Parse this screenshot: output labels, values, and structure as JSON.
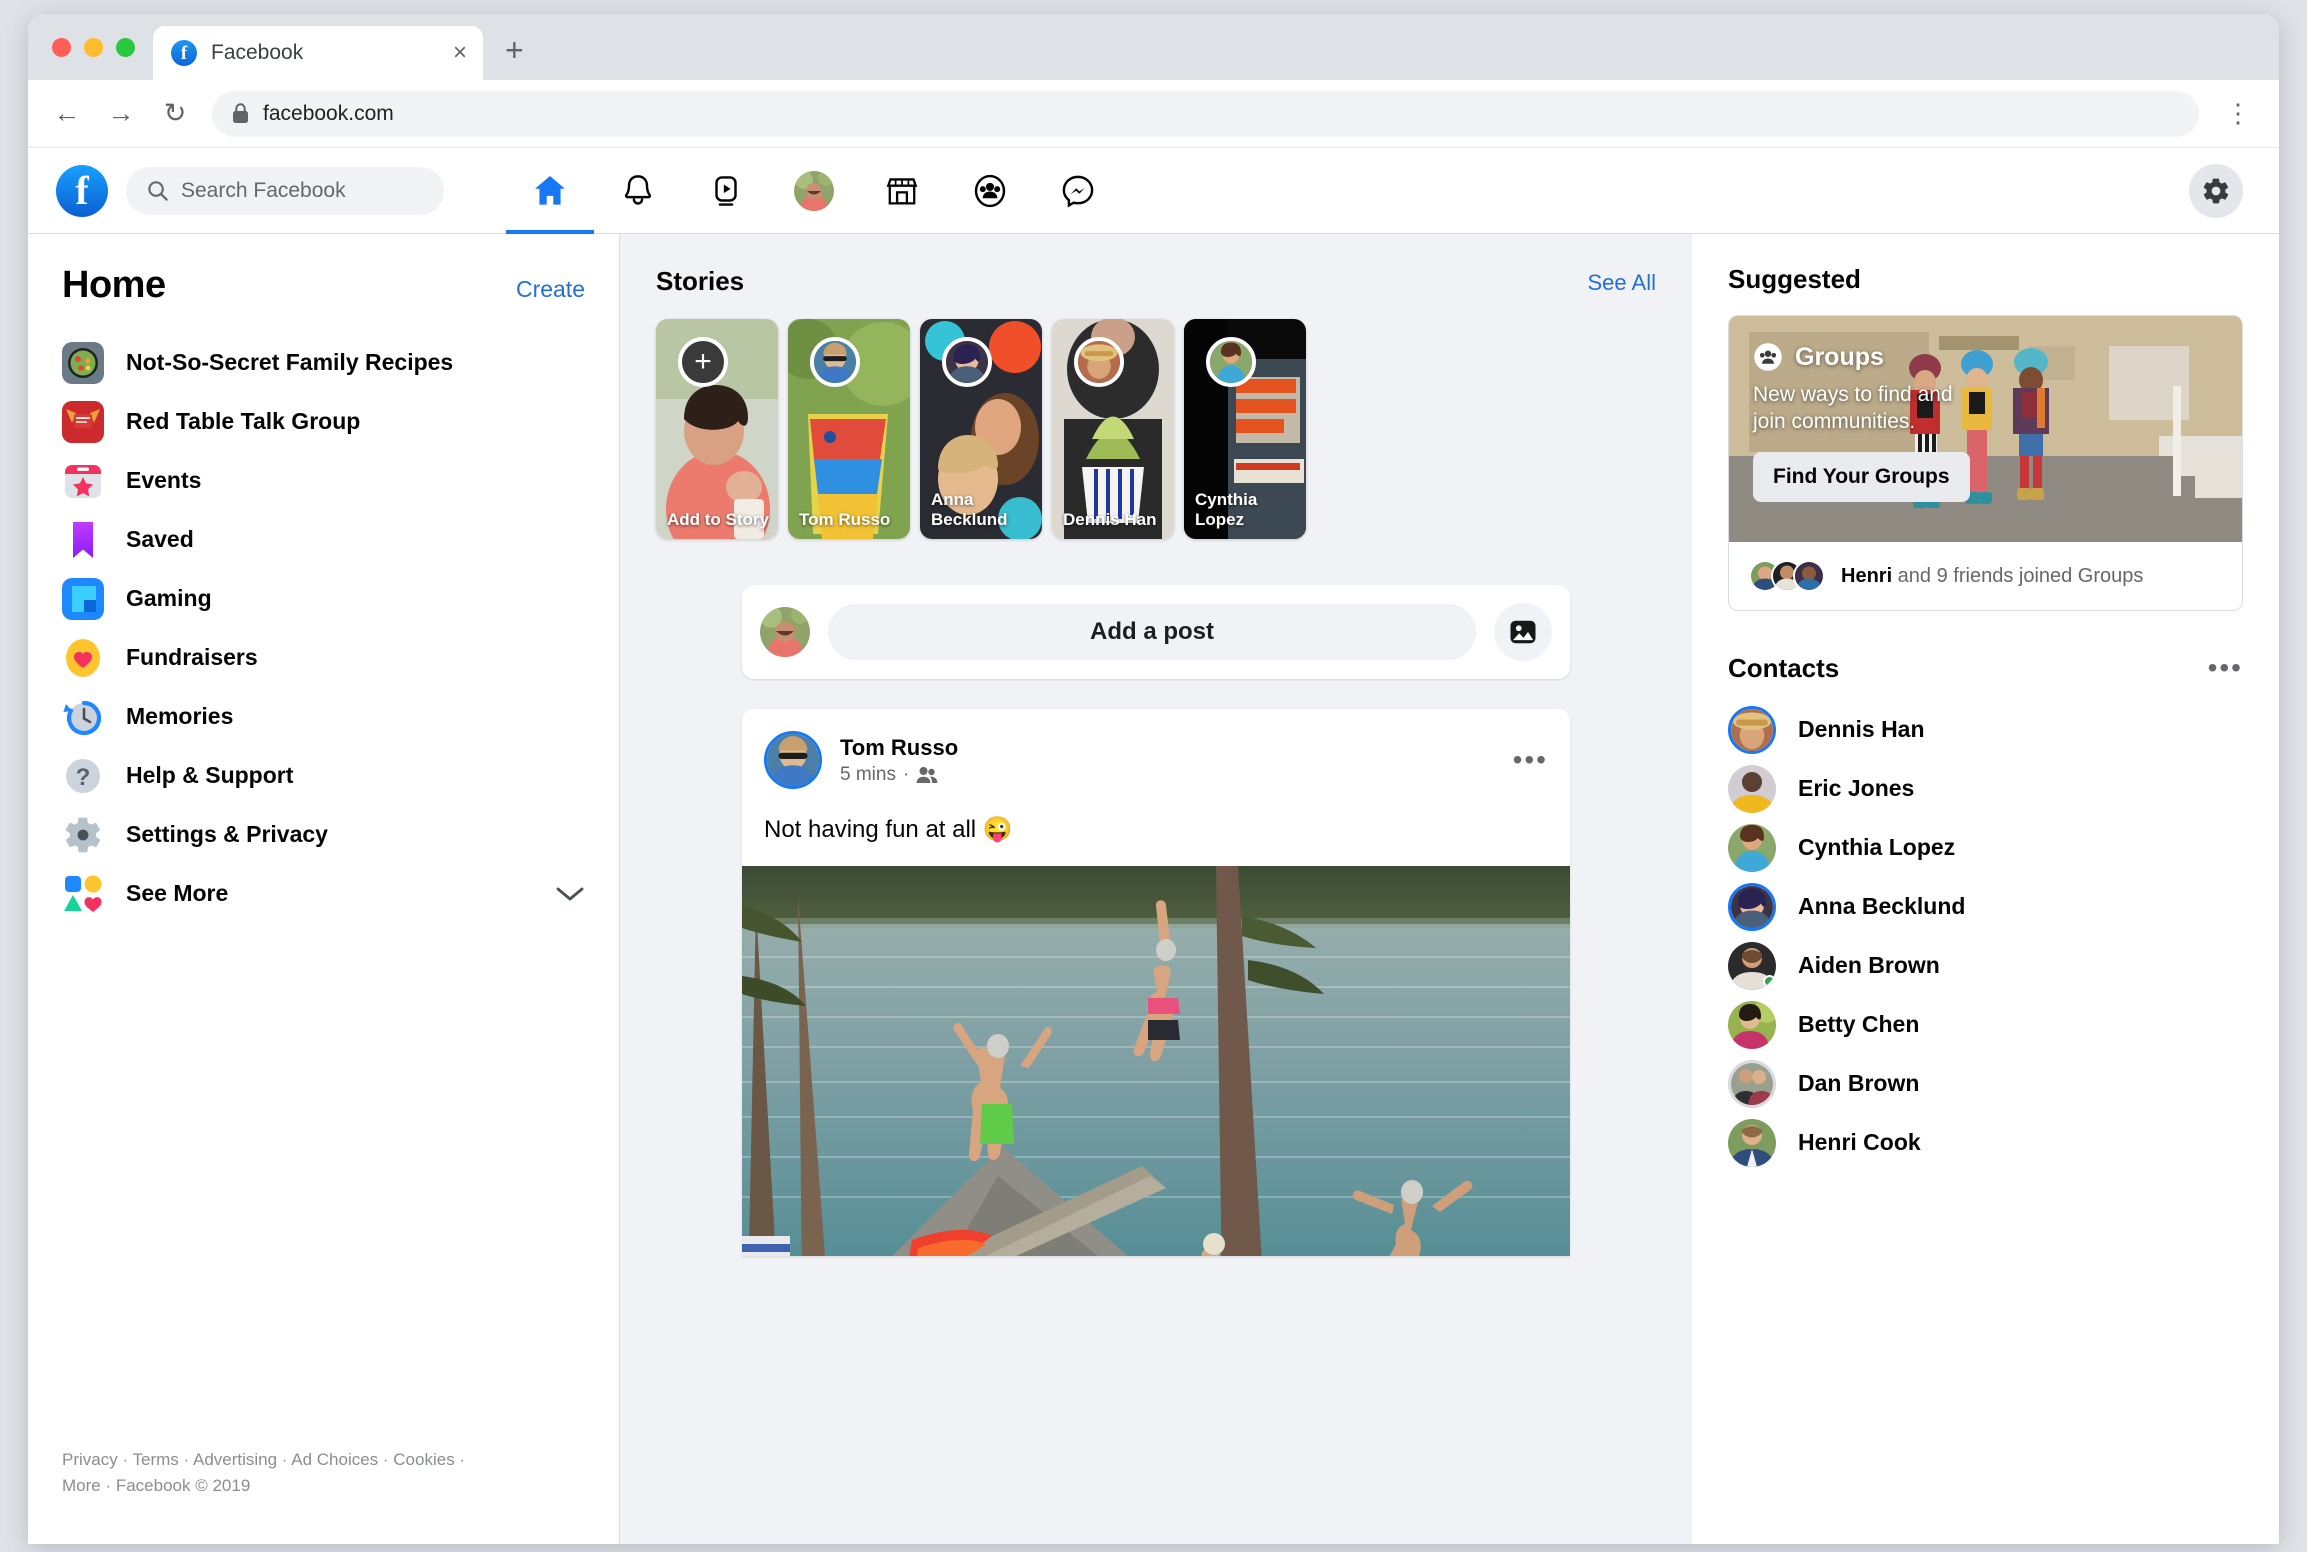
{
  "browser": {
    "tab_title": "Facebook",
    "tab_favicon": "facebook-f-icon",
    "close_glyph": "×",
    "new_tab_glyph": "+",
    "back_glyph": "←",
    "forward_glyph": "→",
    "reload_glyph": "↻",
    "lock_glyph": "🔒",
    "url": "facebook.com",
    "menu_glyph": "⋮"
  },
  "header": {
    "logo_letter": "f",
    "search_placeholder": "Search Facebook",
    "nav": [
      {
        "name": "home",
        "label": "Home",
        "active": true
      },
      {
        "name": "notifications",
        "label": "Notifications",
        "active": false
      },
      {
        "name": "watch",
        "label": "Watch",
        "active": false
      },
      {
        "name": "profile",
        "label": "Profile",
        "active": false
      },
      {
        "name": "marketplace",
        "label": "Marketplace",
        "active": false
      },
      {
        "name": "groups",
        "label": "Groups",
        "active": false
      },
      {
        "name": "messenger",
        "label": "Messenger",
        "active": false
      }
    ],
    "settings_label": "Settings"
  },
  "sidebar": {
    "title": "Home",
    "create_label": "Create",
    "items": [
      {
        "label": "Not-So-Secret Family Recipes",
        "icon": "group-photo-icon"
      },
      {
        "label": "Red Table Talk Group",
        "icon": "group-photo-icon"
      },
      {
        "label": "Events",
        "icon": "events-calendar-icon"
      },
      {
        "label": "Saved",
        "icon": "bookmark-icon"
      },
      {
        "label": "Gaming",
        "icon": "gaming-icon"
      },
      {
        "label": "Fundraisers",
        "icon": "heart-icon"
      },
      {
        "label": "Memories",
        "icon": "clock-icon"
      },
      {
        "label": "Help & Support",
        "icon": "question-mark-icon"
      },
      {
        "label": "Settings & Privacy",
        "icon": "gear-icon"
      },
      {
        "label": "See More",
        "icon": "shapes-icon",
        "chevron": "⌄"
      }
    ],
    "footer_line1": "Privacy · Terms · Advertising · Ad Choices · Cookies ·",
    "footer_line2": "More · Facebook © 2019"
  },
  "stories": {
    "title": "Stories",
    "see_all_label": "See All",
    "cards": [
      {
        "name": "Add to Story",
        "type": "add",
        "plus_glyph": "+"
      },
      {
        "name": "Tom Russo",
        "type": "story"
      },
      {
        "name": "Anna Becklund",
        "type": "story"
      },
      {
        "name": "Dennis Han",
        "type": "story"
      },
      {
        "name": "Cynthia Lopez",
        "type": "story"
      }
    ]
  },
  "composer": {
    "placeholder": "Add a post",
    "photo_icon": "photo-icon"
  },
  "post": {
    "author": "Tom Russo",
    "time": "5 mins",
    "separator": "·",
    "audience_icon": "friends-icon",
    "menu_glyph": "•••",
    "text": "Not having fun at all 😜"
  },
  "suggested": {
    "title": "Suggested",
    "badge_label": "Groups",
    "badge_icon": "groups-icon",
    "subtitle": "New ways to find and join communities.",
    "button_label": "Find Your Groups",
    "footer_name": "Henri",
    "footer_rest": " and 9 friends joined Groups"
  },
  "contacts": {
    "title": "Contacts",
    "menu_glyph": "•••",
    "items": [
      {
        "name": "Dennis Han",
        "ring": "blue",
        "online": false
      },
      {
        "name": "Eric Jones",
        "ring": "none",
        "online": false
      },
      {
        "name": "Cynthia Lopez",
        "ring": "none",
        "online": false
      },
      {
        "name": "Anna Becklund",
        "ring": "blue",
        "online": false
      },
      {
        "name": "Aiden Brown",
        "ring": "none",
        "online": true
      },
      {
        "name": "Betty Chen",
        "ring": "none",
        "online": false
      },
      {
        "name": "Dan Brown",
        "ring": "gray",
        "online": false
      },
      {
        "name": "Henri Cook",
        "ring": "none",
        "online": false
      }
    ]
  },
  "colors": {
    "brand_blue": "#1877f2",
    "link_blue": "#216fdb",
    "page_bg": "#f0f2f5",
    "online_green": "#31a24c"
  }
}
